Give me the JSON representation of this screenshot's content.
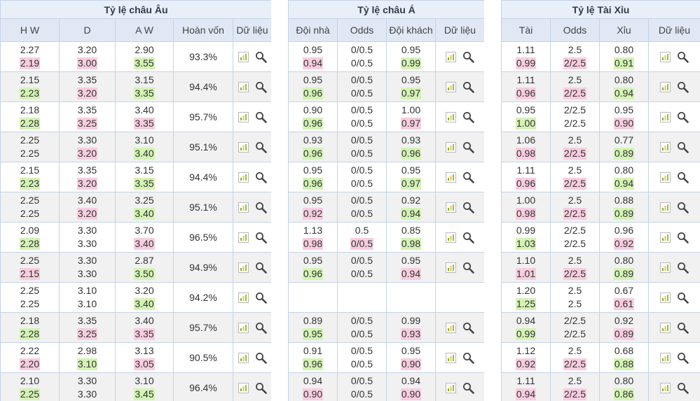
{
  "europe": {
    "title": "Tỷ lệ châu Âu",
    "headers": [
      "H W",
      "D",
      "A W",
      "Hoàn vốn",
      "Dữ liệu"
    ],
    "rows": [
      {
        "hw": [
          "2.27",
          "2.19"
        ],
        "d": [
          "3.20",
          "3.00"
        ],
        "aw": [
          "2.90",
          "3.55"
        ],
        "payout": "93.3%",
        "hl": {
          "hw": "pink",
          "d": "pink",
          "aw": "green"
        }
      },
      {
        "hw": [
          "2.15",
          "2.23"
        ],
        "d": [
          "3.35",
          "3.20"
        ],
        "aw": [
          "3.15",
          "3.35"
        ],
        "payout": "94.4%",
        "hl": {
          "hw": "green",
          "d": "pink",
          "aw": "green"
        }
      },
      {
        "hw": [
          "2.18",
          "2.28"
        ],
        "d": [
          "3.35",
          "3.25"
        ],
        "aw": [
          "3.40",
          "3.35"
        ],
        "payout": "95.7%",
        "hl": {
          "hw": "green",
          "d": "pink",
          "aw": "pink"
        }
      },
      {
        "hw": [
          "2.25",
          "2.25"
        ],
        "d": [
          "3.30",
          "3.20"
        ],
        "aw": [
          "3.10",
          "3.40"
        ],
        "payout": "95.1%",
        "hl": {
          "hw": "",
          "d": "pink",
          "aw": "green"
        }
      },
      {
        "hw": [
          "2.15",
          "2.23"
        ],
        "d": [
          "3.35",
          "3.20"
        ],
        "aw": [
          "3.15",
          "3.35"
        ],
        "payout": "94.4%",
        "hl": {
          "hw": "green",
          "d": "pink",
          "aw": "green"
        }
      },
      {
        "hw": [
          "2.25",
          "2.25"
        ],
        "d": [
          "3.40",
          "3.20"
        ],
        "aw": [
          "3.25",
          "3.40"
        ],
        "payout": "95.1%",
        "hl": {
          "hw": "",
          "d": "pink",
          "aw": "green"
        }
      },
      {
        "hw": [
          "2.09",
          "2.28"
        ],
        "d": [
          "3.30",
          "3.30"
        ],
        "aw": [
          "3.70",
          "3.40"
        ],
        "payout": "96.5%",
        "hl": {
          "hw": "green",
          "d": "",
          "aw": "pink"
        }
      },
      {
        "hw": [
          "2.25",
          "2.15"
        ],
        "d": [
          "3.30",
          "3.30"
        ],
        "aw": [
          "2.87",
          "3.50"
        ],
        "payout": "94.9%",
        "hl": {
          "hw": "pink",
          "d": "",
          "aw": "green"
        }
      },
      {
        "hw": [
          "2.25",
          "2.25"
        ],
        "d": [
          "3.10",
          "3.10"
        ],
        "aw": [
          "3.20",
          "3.40"
        ],
        "payout": "94.2%",
        "hl": {
          "hw": "",
          "d": "",
          "aw": "green"
        }
      },
      {
        "hw": [
          "2.18",
          "2.28"
        ],
        "d": [
          "3.35",
          "3.25"
        ],
        "aw": [
          "3.40",
          "3.35"
        ],
        "payout": "95.7%",
        "hl": {
          "hw": "green",
          "d": "pink",
          "aw": "pink"
        }
      },
      {
        "hw": [
          "2.22",
          "2.20"
        ],
        "d": [
          "2.98",
          "3.10"
        ],
        "aw": [
          "3.13",
          "3.05"
        ],
        "payout": "90.5%",
        "hl": {
          "hw": "pink",
          "d": "green",
          "aw": "pink"
        }
      },
      {
        "hw": [
          "2.10",
          "2.25"
        ],
        "d": [
          "3.30",
          "3.30"
        ],
        "aw": [
          "3.10",
          "3.45"
        ],
        "payout": "96.4%",
        "hl": {
          "hw": "green",
          "d": "",
          "aw": "green"
        }
      }
    ]
  },
  "asia": {
    "title": "Tỷ lệ châu Á",
    "headers": [
      "Đội nhà",
      "Odds",
      "Đội khách",
      "Dữ liệu"
    ],
    "rows": [
      {
        "home": [
          "0.95",
          "0.94"
        ],
        "odds": [
          "0/0.5",
          "0/0.5"
        ],
        "away": [
          "0.95",
          "0.99"
        ],
        "hl": {
          "home": "pink",
          "odds": "",
          "away": "green"
        }
      },
      {
        "home": [
          "0.95",
          "0.96"
        ],
        "odds": [
          "0/0.5",
          "0/0.5"
        ],
        "away": [
          "0.95",
          "0.97"
        ],
        "hl": {
          "home": "green",
          "odds": "",
          "away": "green"
        }
      },
      {
        "home": [
          "0.90",
          "0.96"
        ],
        "odds": [
          "0/0.5",
          "0/0.5"
        ],
        "away": [
          "1.00",
          "0.97"
        ],
        "hl": {
          "home": "green",
          "odds": "",
          "away": "pink"
        }
      },
      {
        "home": [
          "0.93",
          "0.96"
        ],
        "odds": [
          "0/0.5",
          "0/0.5"
        ],
        "away": [
          "0.93",
          "0.96"
        ],
        "hl": {
          "home": "green",
          "odds": "",
          "away": "green"
        }
      },
      {
        "home": [
          "0.95",
          "0.96"
        ],
        "odds": [
          "0/0.5",
          "0/0.5"
        ],
        "away": [
          "0.95",
          "0.97"
        ],
        "hl": {
          "home": "green",
          "odds": "",
          "away": "green"
        }
      },
      {
        "home": [
          "0.95",
          "0.92"
        ],
        "odds": [
          "0/0.5",
          "0/0.5"
        ],
        "away": [
          "0.92",
          "0.94"
        ],
        "hl": {
          "home": "pink",
          "odds": "",
          "away": "green"
        }
      },
      {
        "home": [
          "1.13",
          "0.98"
        ],
        "odds": [
          "0.5",
          "0/0.5"
        ],
        "away": [
          "0.85",
          "0.98"
        ],
        "hl": {
          "home": "pink",
          "odds": "pink",
          "away": "green"
        }
      },
      {
        "home": [
          "0.95",
          "0.96"
        ],
        "odds": [
          "0/0.5",
          "0/0.5"
        ],
        "away": [
          "0.95",
          "0.94"
        ],
        "hl": {
          "home": "green",
          "odds": "",
          "away": "pink"
        }
      },
      {
        "empty": true
      },
      {
        "home": [
          "0.89",
          "0.95"
        ],
        "odds": [
          "0/0.5",
          "0/0.5"
        ],
        "away": [
          "0.99",
          "0.93"
        ],
        "hl": {
          "home": "green",
          "odds": "",
          "away": "pink"
        }
      },
      {
        "home": [
          "0.91",
          "0.96"
        ],
        "odds": [
          "0/0.5",
          "0/0.5"
        ],
        "away": [
          "0.95",
          "0.90"
        ],
        "hl": {
          "home": "green",
          "odds": "",
          "away": "pink"
        }
      },
      {
        "home": [
          "0.94",
          "0.90"
        ],
        "odds": [
          "0/0.5",
          "0/0.5"
        ],
        "away": [
          "0.94",
          "0.90"
        ],
        "hl": {
          "home": "pink",
          "odds": "",
          "away": "pink"
        }
      }
    ]
  },
  "overunder": {
    "title": "Tỷ lệ Tài Xỉu",
    "headers": [
      "Tài",
      "Odds",
      "Xỉu",
      "Dữ liệu"
    ],
    "rows": [
      {
        "over": [
          "1.11",
          "0.99"
        ],
        "odds": [
          "2.5",
          "2/2.5"
        ],
        "under": [
          "0.80",
          "0.91"
        ],
        "hl": {
          "over": "pink",
          "odds": "pink",
          "under": "green"
        }
      },
      {
        "over": [
          "1.11",
          "0.96"
        ],
        "odds": [
          "2.5",
          "2/2.5"
        ],
        "under": [
          "0.80",
          "0.94"
        ],
        "hl": {
          "over": "pink",
          "odds": "pink",
          "under": "green"
        }
      },
      {
        "over": [
          "0.95",
          "1.00"
        ],
        "odds": [
          "2/2.5",
          "2/2.5"
        ],
        "under": [
          "0.95",
          "0.90"
        ],
        "hl": {
          "over": "green",
          "odds": "",
          "under": "pink"
        }
      },
      {
        "over": [
          "1.06",
          "0.98"
        ],
        "odds": [
          "2.5",
          "2/2.5"
        ],
        "under": [
          "0.77",
          "0.89"
        ],
        "hl": {
          "over": "pink",
          "odds": "pink",
          "under": "green"
        }
      },
      {
        "over": [
          "1.11",
          "0.96"
        ],
        "odds": [
          "2.5",
          "2/2.5"
        ],
        "under": [
          "0.80",
          "0.94"
        ],
        "hl": {
          "over": "pink",
          "odds": "pink",
          "under": "green"
        }
      },
      {
        "over": [
          "1.00",
          "0.98"
        ],
        "odds": [
          "2.5",
          "2/2.5"
        ],
        "under": [
          "0.88",
          "0.89"
        ],
        "hl": {
          "over": "pink",
          "odds": "pink",
          "under": "green"
        }
      },
      {
        "over": [
          "0.99",
          "1.03"
        ],
        "odds": [
          "2/2.5",
          "2/2.5"
        ],
        "under": [
          "0.96",
          "0.92"
        ],
        "hl": {
          "over": "green",
          "odds": "",
          "under": "pink"
        }
      },
      {
        "over": [
          "1.10",
          "1.01"
        ],
        "odds": [
          "2.5",
          "2/2.5"
        ],
        "under": [
          "0.80",
          "0.89"
        ],
        "hl": {
          "over": "pink",
          "odds": "pink",
          "under": "green"
        }
      },
      {
        "over": [
          "1.20",
          "1.25"
        ],
        "odds": [
          "2.5",
          "2.5"
        ],
        "under": [
          "0.67",
          "0.61"
        ],
        "hl": {
          "over": "green",
          "odds": "",
          "under": "pink"
        }
      },
      {
        "over": [
          "0.94",
          "0.99"
        ],
        "odds": [
          "2/2.5",
          "2/2.5"
        ],
        "under": [
          "0.92",
          "0.89"
        ],
        "hl": {
          "over": "green",
          "odds": "",
          "under": "pink"
        }
      },
      {
        "over": [
          "1.12",
          "0.92"
        ],
        "odds": [
          "2.5",
          "2/2.5"
        ],
        "under": [
          "0.68",
          "0.88"
        ],
        "hl": {
          "over": "pink",
          "odds": "pink",
          "under": "green"
        }
      },
      {
        "over": [
          "1.11",
          "0.94"
        ],
        "odds": [
          "2.5",
          "2/2.5"
        ],
        "under": [
          "0.80",
          "0.86"
        ],
        "hl": {
          "over": "pink",
          "odds": "pink",
          "under": "green"
        }
      }
    ]
  },
  "icons": {
    "chart": "bar-chart-icon",
    "search": "magnifier-icon"
  },
  "colors": {
    "header_bg": "#dfe8f4",
    "title_bg": "#e9eff8",
    "border": "#c5d3e6",
    "alt_row": "#f1f1f1",
    "up_highlight": "#d4f3b5",
    "down_highlight": "#f8cde0"
  }
}
